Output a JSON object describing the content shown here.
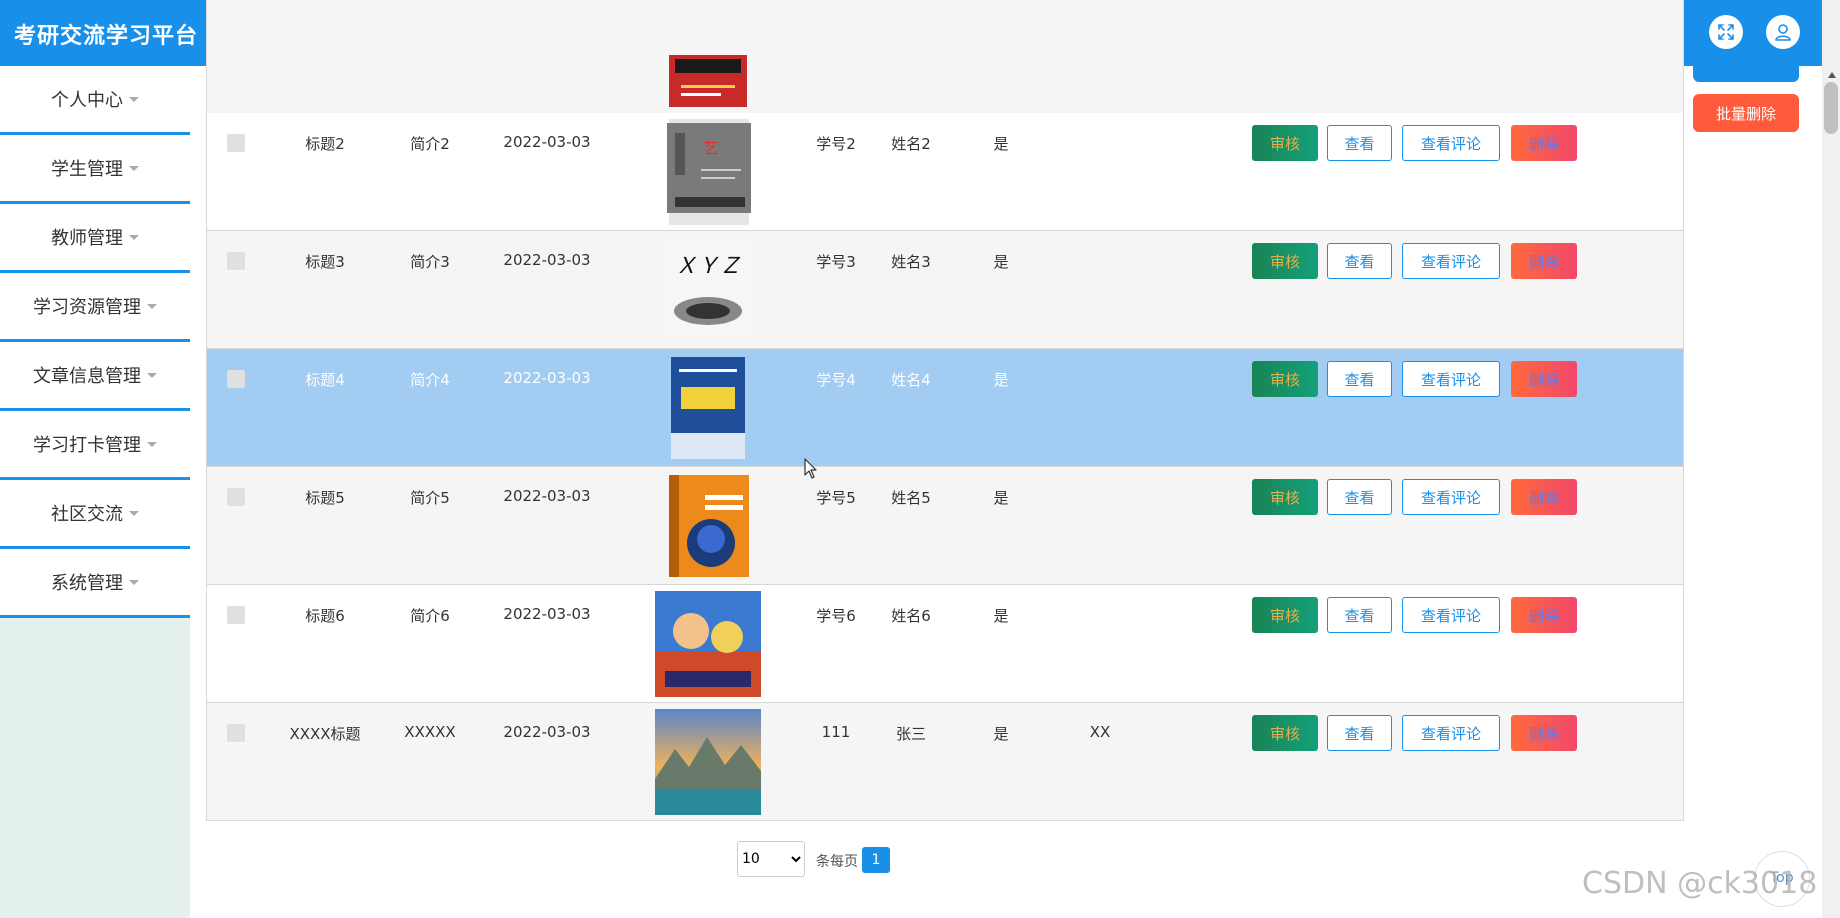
{
  "header": {
    "title": "考研交流学习平台",
    "fullscreen_icon": "fullscreen-icon",
    "user_icon": "user-icon",
    "accent": "#1890ea"
  },
  "sidebar": {
    "items": [
      {
        "label": "个人中心"
      },
      {
        "label": "学生管理"
      },
      {
        "label": "教师管理"
      },
      {
        "label": "学习资源管理"
      },
      {
        "label": "文章信息管理"
      },
      {
        "label": "学习打卡管理"
      },
      {
        "label": "社区交流"
      },
      {
        "label": "系统管理"
      }
    ]
  },
  "actions": {
    "batch_delete": "批量删除"
  },
  "table": {
    "button_labels": {
      "audit": "审核",
      "view": "查看",
      "comments": "查看评论",
      "delete": "删除"
    },
    "rows": [
      {
        "title": "标题2",
        "intro": "简介2",
        "date": "2022-03-03",
        "student_id": "学号2",
        "name": "姓名2",
        "flag": "是",
        "extra": "",
        "cover": "book-cover-art",
        "state": "default"
      },
      {
        "title": "标题3",
        "intro": "简介3",
        "date": "2022-03-03",
        "student_id": "学号3",
        "name": "姓名3",
        "flag": "是",
        "extra": "",
        "cover": "book-cover-calligraphy",
        "state": "default"
      },
      {
        "title": "标题4",
        "intro": "简介4",
        "date": "2022-03-03",
        "student_id": "学号4",
        "name": "姓名4",
        "flag": "是",
        "extra": "",
        "cover": "book-cover-blue",
        "state": "selected"
      },
      {
        "title": "标题5",
        "intro": "简介5",
        "date": "2022-03-03",
        "student_id": "学号5",
        "name": "姓名5",
        "flag": "是",
        "extra": "",
        "cover": "book-cover-memory",
        "state": "default"
      },
      {
        "title": "标题6",
        "intro": "简介6",
        "date": "2022-03-03",
        "student_id": "学号6",
        "name": "姓名6",
        "flag": "是",
        "extra": "",
        "cover": "anime-cover",
        "state": "default"
      },
      {
        "title": "XXXX标题",
        "intro": "XXXXX",
        "date": "2022-03-03",
        "student_id": "111",
        "name": "张三",
        "flag": "是",
        "extra": "XX",
        "cover": "landscape-photo",
        "state": "default"
      }
    ]
  },
  "pagination": {
    "page_size": "10",
    "page_size_options": [
      "10"
    ],
    "per_page_label": "条每页",
    "current_page": "1"
  },
  "back_to_top": "Top",
  "watermark": "CSDN @ck3018"
}
